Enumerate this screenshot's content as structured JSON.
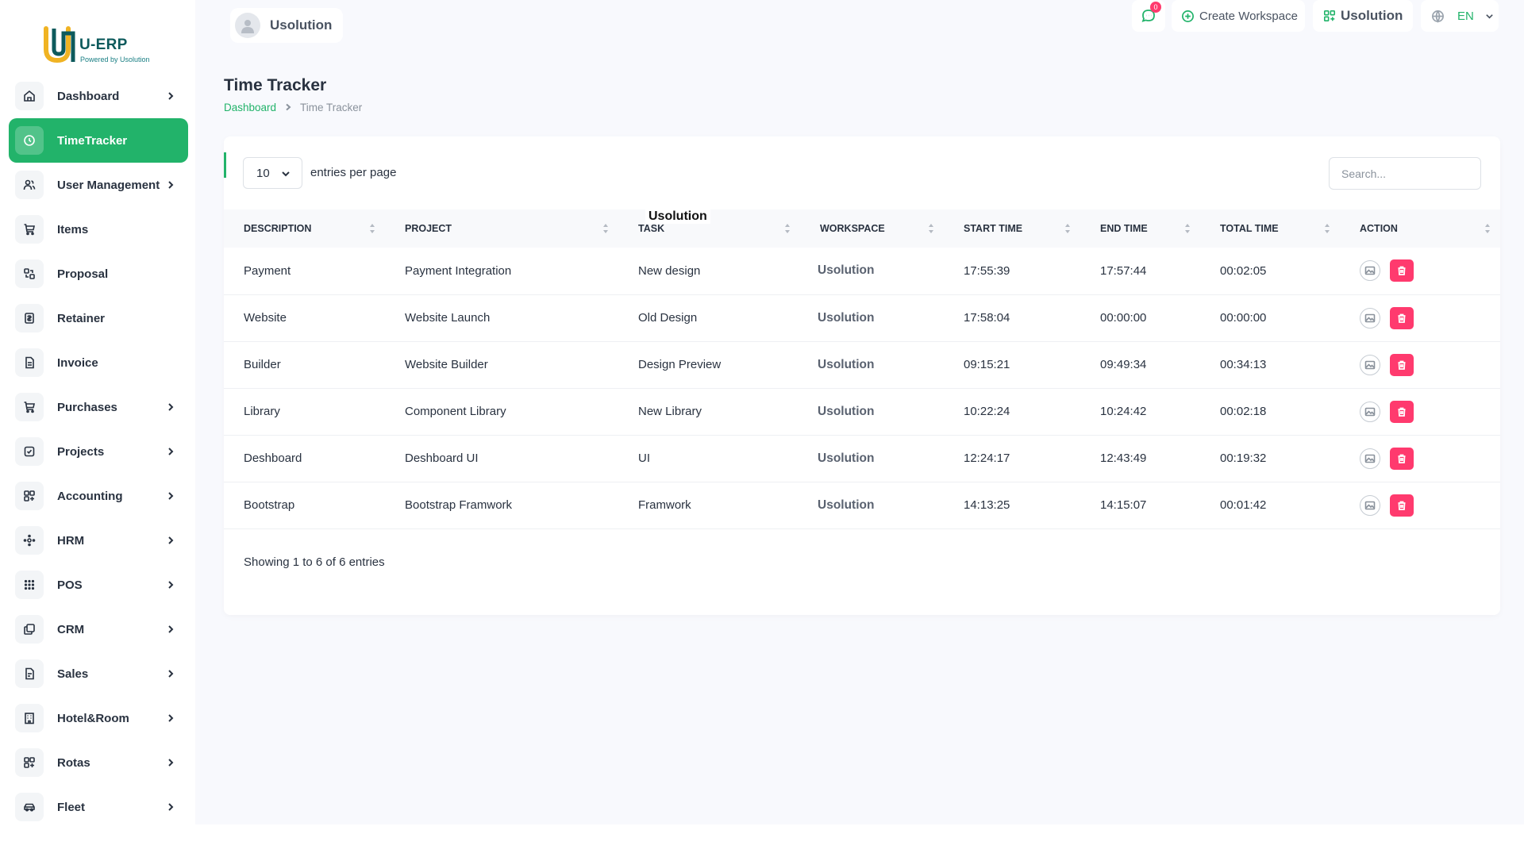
{
  "brand": {
    "title": "U-ERP",
    "subtitle": "Powered by Usolution"
  },
  "header": {
    "user_name": "Usolution",
    "message_count": "0",
    "create_workspace": "Create Workspace",
    "workspace": "Usolution",
    "language": "EN"
  },
  "sidebar": {
    "items": [
      {
        "label": "Dashboard",
        "icon": "home-icon"
      },
      {
        "label": "TimeTracker",
        "icon": "clock-icon"
      },
      {
        "label": "User Management",
        "icon": "users-icon"
      },
      {
        "label": "Items",
        "icon": "cart-icon"
      },
      {
        "label": "Proposal",
        "icon": "proposal-icon"
      },
      {
        "label": "Retainer",
        "icon": "retainer-icon"
      },
      {
        "label": "Invoice",
        "icon": "invoice-icon"
      },
      {
        "label": "Purchases",
        "icon": "cart-icon"
      },
      {
        "label": "Projects",
        "icon": "checkbox-icon"
      },
      {
        "label": "Accounting",
        "icon": "grid-plus-icon"
      },
      {
        "label": "HRM",
        "icon": "hrm-icon"
      },
      {
        "label": "POS",
        "icon": "dots-grid-icon"
      },
      {
        "label": "CRM",
        "icon": "layers-icon"
      },
      {
        "label": "Sales",
        "icon": "file-icon"
      },
      {
        "label": "Hotel&Room",
        "icon": "building-icon"
      },
      {
        "label": "Rotas",
        "icon": "grid-plus-icon"
      },
      {
        "label": "Fleet",
        "icon": "car-icon"
      }
    ]
  },
  "page": {
    "title": "Time Tracker",
    "breadcrumb_home": "Dashboard",
    "breadcrumb_current": "Time Tracker"
  },
  "table": {
    "per_page": "10",
    "per_page_label": "entries per page",
    "search_placeholder": "Search...",
    "overlay_label": "Usolution",
    "headers": [
      "Description",
      "Project",
      "Task",
      "Workspace",
      "Start Time",
      "End Time",
      "Total Time",
      "Action"
    ],
    "rows": [
      {
        "description": "Payment",
        "project": "Payment Integration",
        "task": "New design",
        "workspace": "Usolution",
        "start": "17:55:39",
        "end": "17:57:44",
        "total": "00:02:05"
      },
      {
        "description": "Website",
        "project": "Website Launch",
        "task": "Old Design",
        "workspace": "Usolution",
        "start": "17:58:04",
        "end": "00:00:00",
        "total": "00:00:00"
      },
      {
        "description": "Builder",
        "project": "Website Builder",
        "task": "Design Preview",
        "workspace": "Usolution",
        "start": "09:15:21",
        "end": "09:49:34",
        "total": "00:34:13"
      },
      {
        "description": "Library",
        "project": "Component Library",
        "task": "New Library",
        "workspace": "Usolution",
        "start": "10:22:24",
        "end": "10:24:42",
        "total": "00:02:18"
      },
      {
        "description": "Deshboard",
        "project": "Deshboard UI",
        "task": "UI",
        "workspace": "Usolution",
        "start": "12:24:17",
        "end": "12:43:49",
        "total": "00:19:32"
      },
      {
        "description": "Bootstrap",
        "project": "Bootstrap Framwork",
        "task": "Framwork",
        "workspace": "Usolution",
        "start": "14:13:25",
        "end": "14:15:07",
        "total": "00:01:42"
      }
    ],
    "footer": "Showing 1 to 6 of 6 entries"
  },
  "colors": {
    "accent": "#22b36a",
    "danger": "#ff3a6e",
    "text": "#293240"
  }
}
